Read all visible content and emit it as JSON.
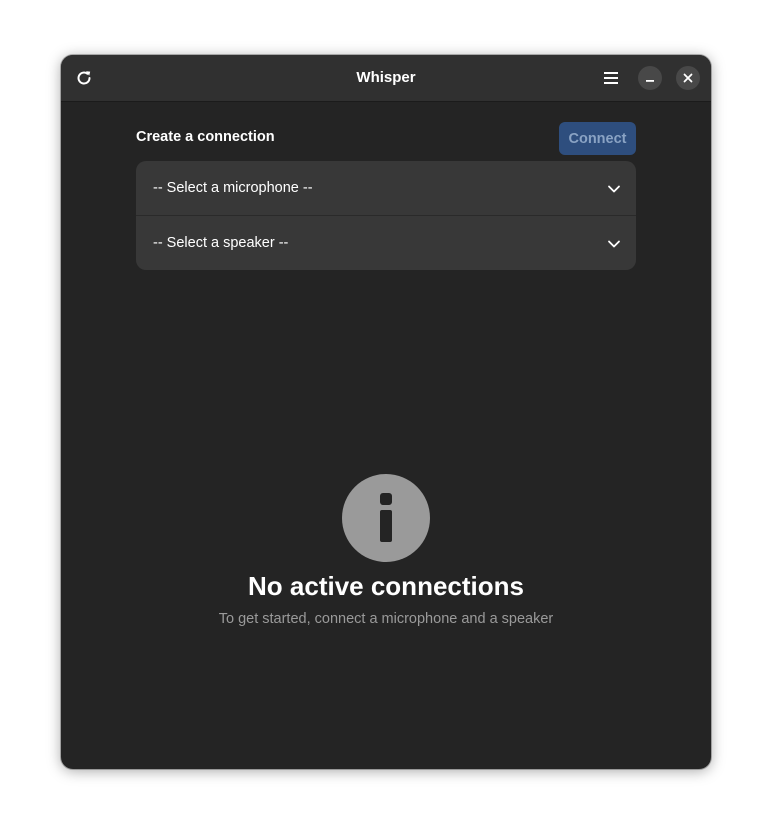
{
  "window": {
    "title": "Whisper"
  },
  "headerbar": {
    "refresh_icon": "refresh-icon",
    "menu_icon": "hamburger-menu-icon",
    "minimize_icon": "minimize-icon",
    "close_icon": "close-icon"
  },
  "connection": {
    "heading": "Create a connection",
    "connect_label": "Connect",
    "microphone_select": "-- Select a microphone --",
    "speaker_select": "-- Select a speaker --"
  },
  "status": {
    "icon": "info-icon",
    "title": "No active connections",
    "description": "To get started, connect a microphone and a speaker"
  },
  "colors": {
    "window_bg": "#242424",
    "headerbar_bg": "#303030",
    "accent_disabled": "#2e4e7e",
    "list_bg": "#383838",
    "status_icon": "#9a9a9a"
  }
}
